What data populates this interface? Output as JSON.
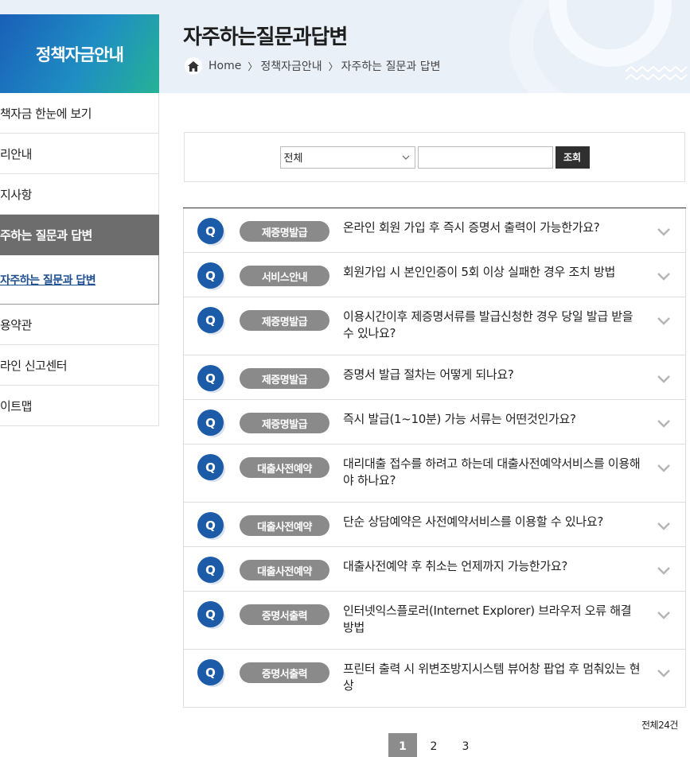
{
  "header": {
    "brand_title": "정책자금안내",
    "page_title": "자주하는질문과답변",
    "breadcrumb": [
      "Home",
      "정책자금안내",
      "자주하는 질문과 답변"
    ]
  },
  "sidebar": {
    "items": [
      {
        "label": "책자금 한눈에 보기",
        "active": false
      },
      {
        "label": "리안내",
        "active": false
      },
      {
        "label": "지사항",
        "active": false
      },
      {
        "label": "주하는 질문과 답변",
        "active": true
      },
      {
        "label": "자주하는 질문과 답변",
        "sub": true
      },
      {
        "label": "용약관",
        "active": false
      },
      {
        "label": "라인 신고센터",
        "active": false
      },
      {
        "label": "이트맵",
        "active": false
      }
    ]
  },
  "search": {
    "select_value": "전체",
    "input_value": "",
    "button_label": "조회"
  },
  "faq": [
    {
      "q": "Q",
      "category": "제증명발급",
      "question": "온라인 회원 가입 후 즉시 증명서 출력이 가능한가요?"
    },
    {
      "q": "Q",
      "category": "서비스안내",
      "question": "회원가입 시 본인인증이 5회 이상 실패한 경우 조치 방법"
    },
    {
      "q": "Q",
      "category": "제증명발급",
      "question": "이용시간이후 제증명서류를 발급신청한 경우 당일 발급 받을 수 있나요?"
    },
    {
      "q": "Q",
      "category": "제증명발급",
      "question": "증명서 발급 절차는 어떻게 되나요?"
    },
    {
      "q": "Q",
      "category": "제증명발급",
      "question": "즉시 발급(1~10분) 가능 서류는 어떤것인가요?"
    },
    {
      "q": "Q",
      "category": "대출사전예약",
      "question": "대리대출 접수를 하려고 하는데 대출사전예약서비스를 이용해야 하나요?"
    },
    {
      "q": "Q",
      "category": "대출사전예약",
      "question": "단순 상담예약은 사전예약서비스를 이용할 수 있나요?"
    },
    {
      "q": "Q",
      "category": "대출사전예약",
      "question": "대출사전예약 후 취소는 언제까지 가능한가요?"
    },
    {
      "q": "Q",
      "category": "증명서출력",
      "question": "인터넷익스플로러(Internet Explorer) 브라우저 오류 해결 방법"
    },
    {
      "q": "Q",
      "category": "증명서출력",
      "question": "프린터 출력 시 위변조방지시스템 뷰어창 팝업 후 멈춰있는 현상"
    }
  ],
  "total_count": "전체24건",
  "pagination": {
    "pages": [
      "1",
      "2",
      "3"
    ],
    "current": "1"
  },
  "colors": {
    "brand_blue": "#1c5ba8",
    "pill_gray": "#8a8a8a",
    "active_menu": "#6d6d6d",
    "sub_link": "#1d4f91"
  },
  "icons": {
    "home": "home-icon",
    "chevron": "chevron-down-icon",
    "select_arrow": "chevron-down-icon"
  }
}
